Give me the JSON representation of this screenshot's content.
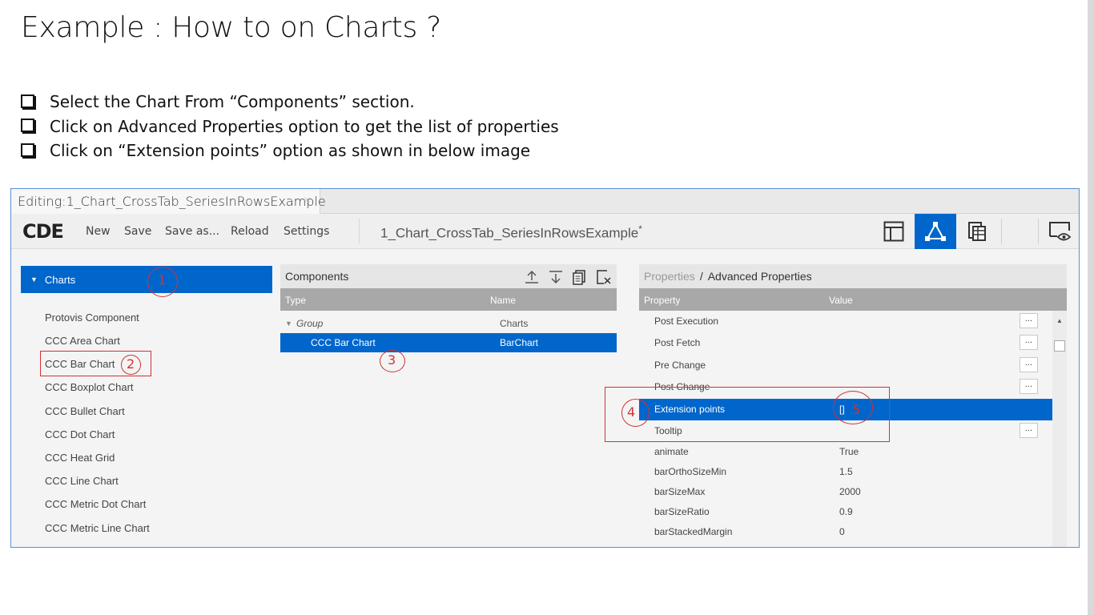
{
  "slide": {
    "title": "Example : How to on Charts ?",
    "bullets": [
      "Select the Chart From “Components” section.",
      "Click on Advanced Properties option to get the list of properties",
      "Click on “Extension points” option as shown in below image"
    ]
  },
  "app": {
    "tab": {
      "label": "Editing:1_Chart_CrossTab_SeriesInRowsExample",
      "close": "×"
    },
    "toolbar": {
      "logo": "CDE",
      "menu": [
        "New",
        "Save",
        "Save as...",
        "Reload",
        "Settings"
      ],
      "dashboard_title": "1_Chart_CrossTab_SeriesInRowsExample",
      "modified_marker": "*",
      "view_icons": [
        "layout-icon",
        "components-icon",
        "datasources-icon",
        "preview-icon"
      ],
      "active_view": "components-icon",
      "accent": "#0066cc"
    },
    "left_panel": {
      "group": "Charts",
      "items": [
        "Protovis Component",
        "CCC Area Chart",
        "CCC Bar Chart",
        "CCC Boxplot Chart",
        "CCC Bullet Chart",
        "CCC Dot Chart",
        "CCC Heat Grid",
        "CCC Line Chart",
        "CCC Metric Dot Chart",
        "CCC Metric Line Chart"
      ]
    },
    "components": {
      "title": "Components",
      "columns": [
        "Type",
        "Name"
      ],
      "rows": [
        {
          "type": "Group",
          "name": "Charts"
        },
        {
          "type": "CCC Bar Chart",
          "name": "BarChart"
        }
      ],
      "header_icons": [
        "upload-icon",
        "download-icon",
        "duplicate-icon",
        "delete-icon"
      ]
    },
    "properties": {
      "breadcrumb_link": "Properties",
      "breadcrumb_sep": "/",
      "breadcrumb_current": "Advanced Properties",
      "columns": [
        "Property",
        "Value"
      ],
      "rows": [
        {
          "name": "Post Execution",
          "value": "",
          "button": "..."
        },
        {
          "name": "Post Fetch",
          "value": "",
          "button": "..."
        },
        {
          "name": "Pre Change",
          "value": "",
          "button": "..."
        },
        {
          "name": "Post Change",
          "value": "",
          "button": "..."
        },
        {
          "name": "Extension points",
          "value": "[]",
          "button": ""
        },
        {
          "name": "Tooltip",
          "value": "",
          "button": "..."
        },
        {
          "name": "animate",
          "value": "True",
          "button": ""
        },
        {
          "name": "barOrthoSizeMin",
          "value": "1.5",
          "button": ""
        },
        {
          "name": "barSizeMax",
          "value": "2000",
          "button": ""
        },
        {
          "name": "barSizeRatio",
          "value": "0.9",
          "button": ""
        },
        {
          "name": "barStackedMargin",
          "value": "0",
          "button": ""
        }
      ]
    }
  },
  "annotations": {
    "color": "#d23232",
    "labels": [
      "1",
      "2",
      "3",
      "4",
      "5"
    ]
  }
}
